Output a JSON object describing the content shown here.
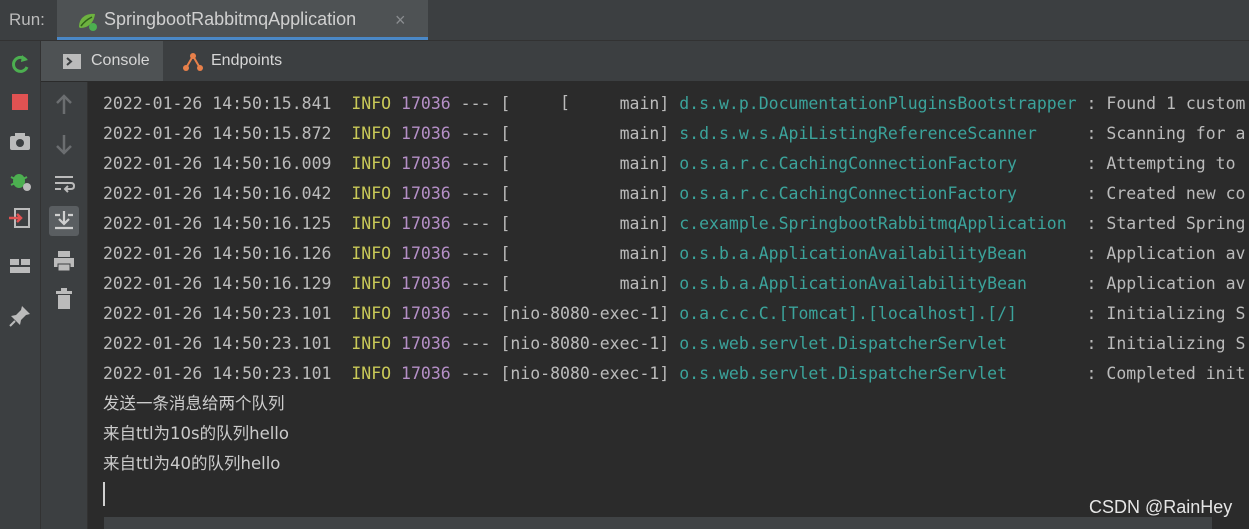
{
  "runbar": {
    "label": "Run:",
    "tab_title": "SpringbootRabbitmqApplication",
    "close": "×"
  },
  "subtabs": {
    "console": "Console",
    "endpoints": "Endpoints"
  },
  "log_lines": [
    {
      "ts": "2022-01-26 14:50:15.841",
      "lvl": "INFO",
      "pid": "17036",
      "dash": "---",
      "thread": "[           main]",
      "logger": "d.s.w.p.DocumentationPluginsBootstrapper",
      "msg": ": Found 1 custom"
    },
    {
      "ts": "2022-01-26 14:50:15.872",
      "lvl": "INFO",
      "pid": "17036",
      "dash": "---",
      "thread": "[           main]",
      "logger": "s.d.s.w.s.ApiListingReferenceScanner    ",
      "msg": ": Scanning for a"
    },
    {
      "ts": "2022-01-26 14:50:16.009",
      "lvl": "INFO",
      "pid": "17036",
      "dash": "---",
      "thread": "[           main]",
      "logger": "o.s.a.r.c.CachingConnectionFactory      ",
      "msg": ": Attempting to "
    },
    {
      "ts": "2022-01-26 14:50:16.042",
      "lvl": "INFO",
      "pid": "17036",
      "dash": "---",
      "thread": "[           main]",
      "logger": "o.s.a.r.c.CachingConnectionFactory      ",
      "msg": ": Created new co"
    },
    {
      "ts": "2022-01-26 14:50:16.125",
      "lvl": "INFO",
      "pid": "17036",
      "dash": "---",
      "thread": "[           main]",
      "logger": "c.example.SpringbootRabbitmqApplication ",
      "msg": ": Started Spring"
    },
    {
      "ts": "2022-01-26 14:50:16.126",
      "lvl": "INFO",
      "pid": "17036",
      "dash": "---",
      "thread": "[           main]",
      "logger": "o.s.b.a.ApplicationAvailabilityBean     ",
      "msg": ": Application av"
    },
    {
      "ts": "2022-01-26 14:50:16.129",
      "lvl": "INFO",
      "pid": "17036",
      "dash": "---",
      "thread": "[           main]",
      "logger": "o.s.b.a.ApplicationAvailabilityBean     ",
      "msg": ": Application av"
    },
    {
      "ts": "2022-01-26 14:50:23.101",
      "lvl": "INFO",
      "pid": "17036",
      "dash": "---",
      "thread": "[nio-8080-exec-1]",
      "logger": "o.a.c.c.C.[Tomcat].[localhost].[/]      ",
      "msg": ": Initializing S"
    },
    {
      "ts": "2022-01-26 14:50:23.101",
      "lvl": "INFO",
      "pid": "17036",
      "dash": "---",
      "thread": "[nio-8080-exec-1]",
      "logger": "o.s.web.servlet.DispatcherServlet       ",
      "msg": ": Initializing S"
    },
    {
      "ts": "2022-01-26 14:50:23.101",
      "lvl": "INFO",
      "pid": "17036",
      "dash": "---",
      "thread": "[nio-8080-exec-1]",
      "logger": "o.s.web.servlet.DispatcherServlet       ",
      "msg": ": Completed init"
    }
  ],
  "output_lines": [
    "发送一条消息给两个队列",
    "来自ttl为10s的队列hello",
    "来自ttl为40的队列hello"
  ],
  "watermark": "CSDN @RainHey",
  "colors": {
    "accent": "#4a88c7",
    "info": "#c9c958",
    "pid": "#b58fc7",
    "logger": "#3ba39b",
    "rerun": "#4caf50",
    "stop": "#e05252"
  }
}
